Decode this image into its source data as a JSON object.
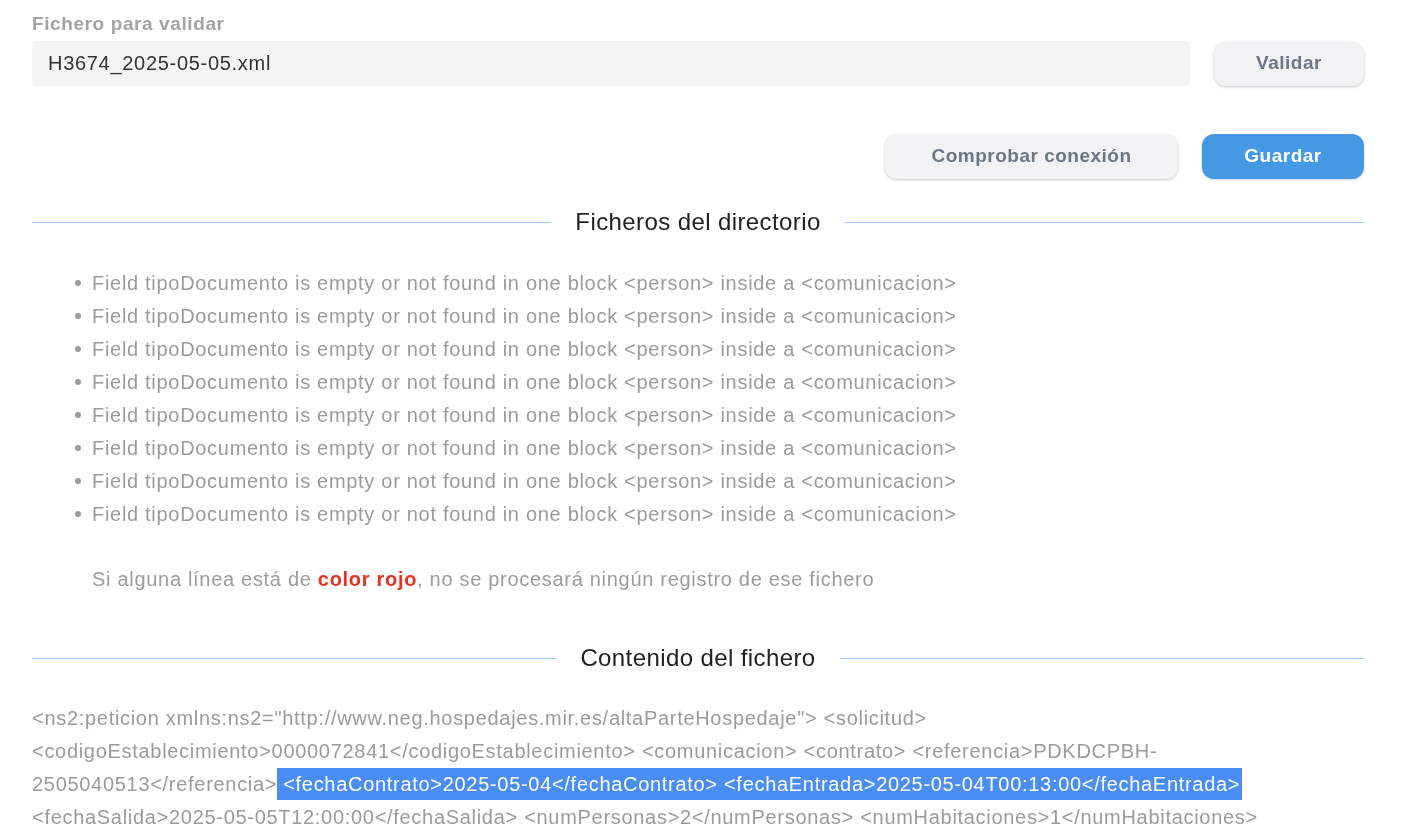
{
  "file_field": {
    "label": "Fichero para validar",
    "value": "H3674_2025-05-05.xml"
  },
  "validate_button": {
    "label": "Validar",
    "kind": "secondary"
  },
  "actions": [
    {
      "label": "Comprobar conexión",
      "kind": "secondary"
    },
    {
      "label": "Guardar",
      "kind": "primary"
    }
  ],
  "directory_section": {
    "title": "Ficheros del directorio",
    "messages": [
      "Field tipoDocumento is empty or not found in one block <person> inside a <comunicacion>",
      "Field tipoDocumento is empty or not found in one block <person> inside a <comunicacion>",
      "Field tipoDocumento is empty or not found in one block <person> inside a <comunicacion>",
      "Field tipoDocumento is empty or not found in one block <person> inside a <comunicacion>",
      "Field tipoDocumento is empty or not found in one block <person> inside a <comunicacion>",
      "Field tipoDocumento is empty or not found in one block <person> inside a <comunicacion>",
      "Field tipoDocumento is empty or not found in one block <person> inside a <comunicacion>",
      "Field tipoDocumento is empty or not found in one block <person> inside a <comunicacion>"
    ],
    "note": "Si alguna línea está de **color rojo**, no se procesará ningún registro de ese fichero"
  },
  "content_section": {
    "title": "Contenido del fichero",
    "lines": [
      {
        "segments": [
          {
            "text": "<ns2:peticion xmlns:ns2=\"http://www.neg.hospedajes.mir.es/altaParteHospedaje\"> <solicitud>",
            "selected": false
          }
        ]
      },
      {
        "segments": [
          {
            "text": "<codigoEstablecimiento>0000072841</codigoEstablecimiento> <comunicacion> <contrato> <referencia>PDKDCPBH-",
            "selected": false
          }
        ]
      },
      {
        "segments": [
          {
            "text": "2505040513</referencia>",
            "selected": false
          },
          {
            "text": "<fechaContrato>2025-05-04</fechaContrato> <fechaEntrada>2025-05-04T00:13:00</fechaEntrada>",
            "selected": true
          }
        ]
      },
      {
        "segments": [
          {
            "text": "<fechaSalida>2025-05-05T12:00:00</fechaSalida> <numPersonas>2</numPersonas> <numHabitaciones>1</numHabitaciones>",
            "selected": false
          }
        ]
      }
    ]
  }
}
